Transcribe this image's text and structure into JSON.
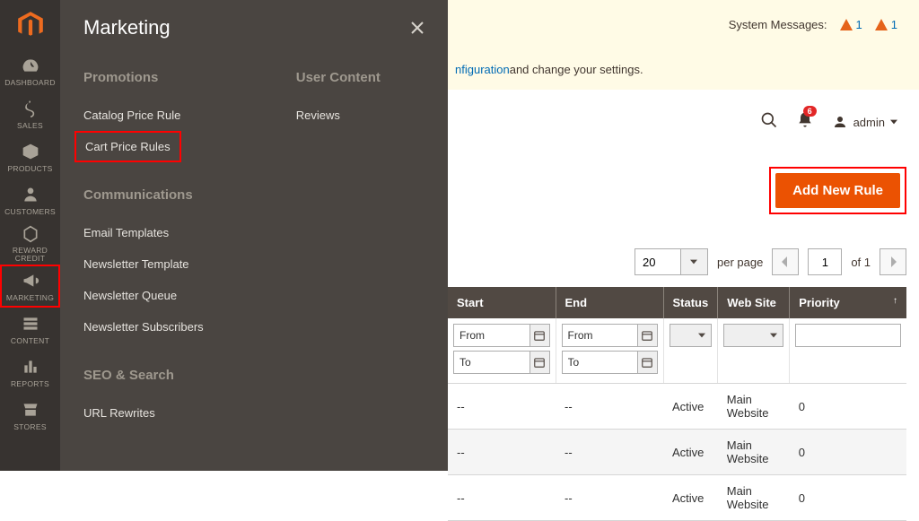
{
  "panel_title": "Marketing",
  "rail": {
    "items": [
      {
        "key": "dashboard",
        "label": "DASHBOARD"
      },
      {
        "key": "sales",
        "label": "SALES"
      },
      {
        "key": "products",
        "label": "PRODUCTS"
      },
      {
        "key": "customers",
        "label": "CUSTOMERS"
      },
      {
        "key": "reward",
        "label": "REWARD CREDIT"
      },
      {
        "key": "marketing",
        "label": "MARKETING"
      },
      {
        "key": "content",
        "label": "CONTENT"
      },
      {
        "key": "reports",
        "label": "REPORTS"
      },
      {
        "key": "stores",
        "label": "STORES"
      }
    ]
  },
  "sections": {
    "promotions_title": "Promotions",
    "catalog_price_rule": "Catalog Price Rule",
    "cart_price_rules": "Cart Price Rules",
    "communications_title": "Communications",
    "email_templates": "Email Templates",
    "newsletter_template": "Newsletter Template",
    "newsletter_queue": "Newsletter Queue",
    "newsletter_subscribers": "Newsletter Subscribers",
    "seo_title": "SEO & Search",
    "url_rewrites": "URL Rewrites",
    "user_content_title": "User Content",
    "reviews": "Reviews"
  },
  "sysbar": {
    "label": "System Messages:",
    "count1": "1",
    "count2": "1"
  },
  "hint": {
    "link_text": "nfiguration",
    "rest": " and change your settings."
  },
  "account": {
    "name": "admin",
    "notif_count": "6"
  },
  "add_button": "Add New Rule",
  "pager": {
    "page_size": "20",
    "per_page_label": "per page",
    "current": "1",
    "of_label": "of 1"
  },
  "table": {
    "headers": {
      "start": "Start",
      "end": "End",
      "status": "Status",
      "website": "Web Site",
      "priority": "Priority"
    },
    "filters": {
      "from": "From",
      "to": "To"
    },
    "rows": [
      {
        "start": "--",
        "end": "--",
        "status": "Active",
        "site": "Main Website",
        "priority": "0"
      },
      {
        "start": "--",
        "end": "--",
        "status": "Active",
        "site": "Main Website",
        "priority": "0"
      },
      {
        "start": "--",
        "end": "--",
        "status": "Active",
        "site": "Main Website",
        "priority": "0"
      }
    ]
  }
}
